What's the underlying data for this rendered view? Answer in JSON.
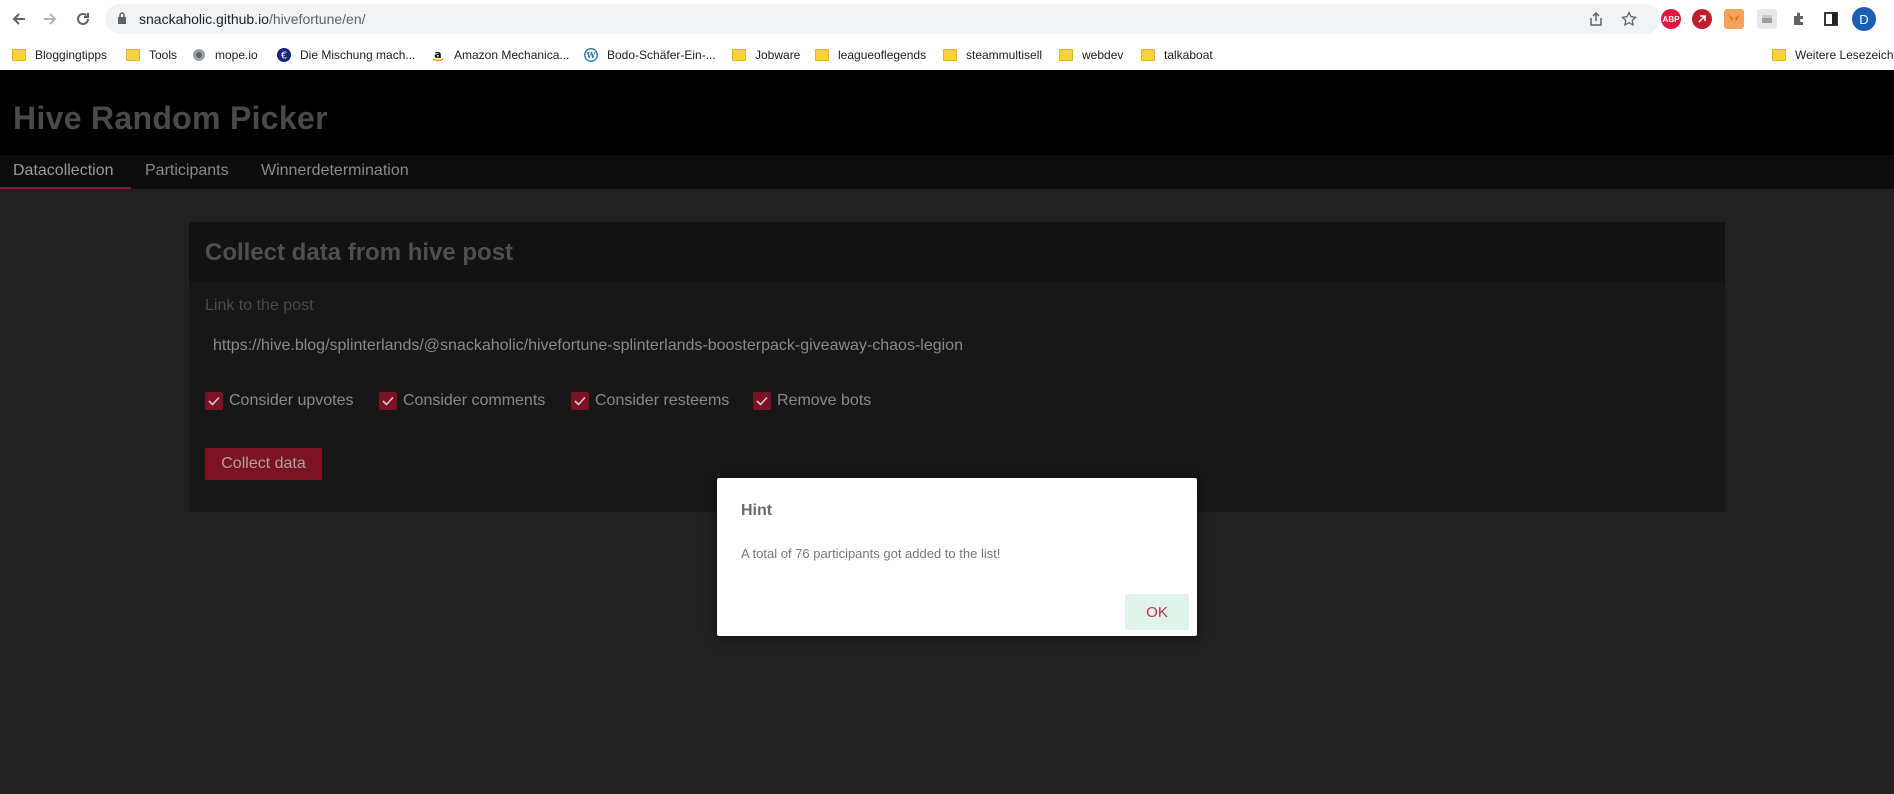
{
  "browser": {
    "url_host": "snackaholic.github.io",
    "url_path": "/hivefortune/en/",
    "profile_initial": "D",
    "extensions": [
      {
        "name": "adblock-plus",
        "label": "ABP",
        "color": "#e3173e"
      },
      {
        "name": "extension-2",
        "label": "",
        "color": "#c11c2b"
      },
      {
        "name": "metamask",
        "label": "",
        "color": "#e2761b"
      },
      {
        "name": "extension-4",
        "label": "",
        "color": "#8a8a8a"
      }
    ],
    "bookmarks": [
      {
        "label": "Bloggingtipps",
        "icon": "folder-icon"
      },
      {
        "label": "Tools",
        "icon": "folder-icon"
      },
      {
        "label": "mope.io",
        "icon": "mope-icon"
      },
      {
        "label": "Die Mischung mach...",
        "icon": "euro-icon"
      },
      {
        "label": "Amazon Mechanica...",
        "icon": "amazon-icon"
      },
      {
        "label": "Bodo-Schäfer-Ein-...",
        "icon": "wordpress-icon"
      },
      {
        "label": "Jobware",
        "icon": "folder-icon"
      },
      {
        "label": "leagueoflegends",
        "icon": "folder-icon"
      },
      {
        "label": "steammultisell",
        "icon": "folder-icon"
      },
      {
        "label": "webdev",
        "icon": "folder-icon"
      },
      {
        "label": "talkaboat",
        "icon": "folder-icon"
      }
    ],
    "other_bookmarks": "Weitere Lesezeichen"
  },
  "app": {
    "title": "Hive Random Picker",
    "tabs": [
      "Datacollection",
      "Participants",
      "Winnerdetermination"
    ],
    "active_tab": "Datacollection",
    "accent_color": "#7a1425"
  },
  "card": {
    "title": "Collect data from hive post",
    "link_label": "Link to the post",
    "link_value": "https://hive.blog/splinterlands/@snackaholic/hivefortune-splinterlands-boosterpack-giveaway-chaos-legion",
    "checkboxes": [
      {
        "label": "Consider upvotes",
        "checked": true
      },
      {
        "label": "Consider comments",
        "checked": true
      },
      {
        "label": "Consider resteems",
        "checked": true
      },
      {
        "label": "Remove bots",
        "checked": true
      }
    ],
    "button": "Collect data"
  },
  "dialog": {
    "title": "Hint",
    "message": "A total of 76 participants got added to the list!",
    "ok": "OK"
  }
}
